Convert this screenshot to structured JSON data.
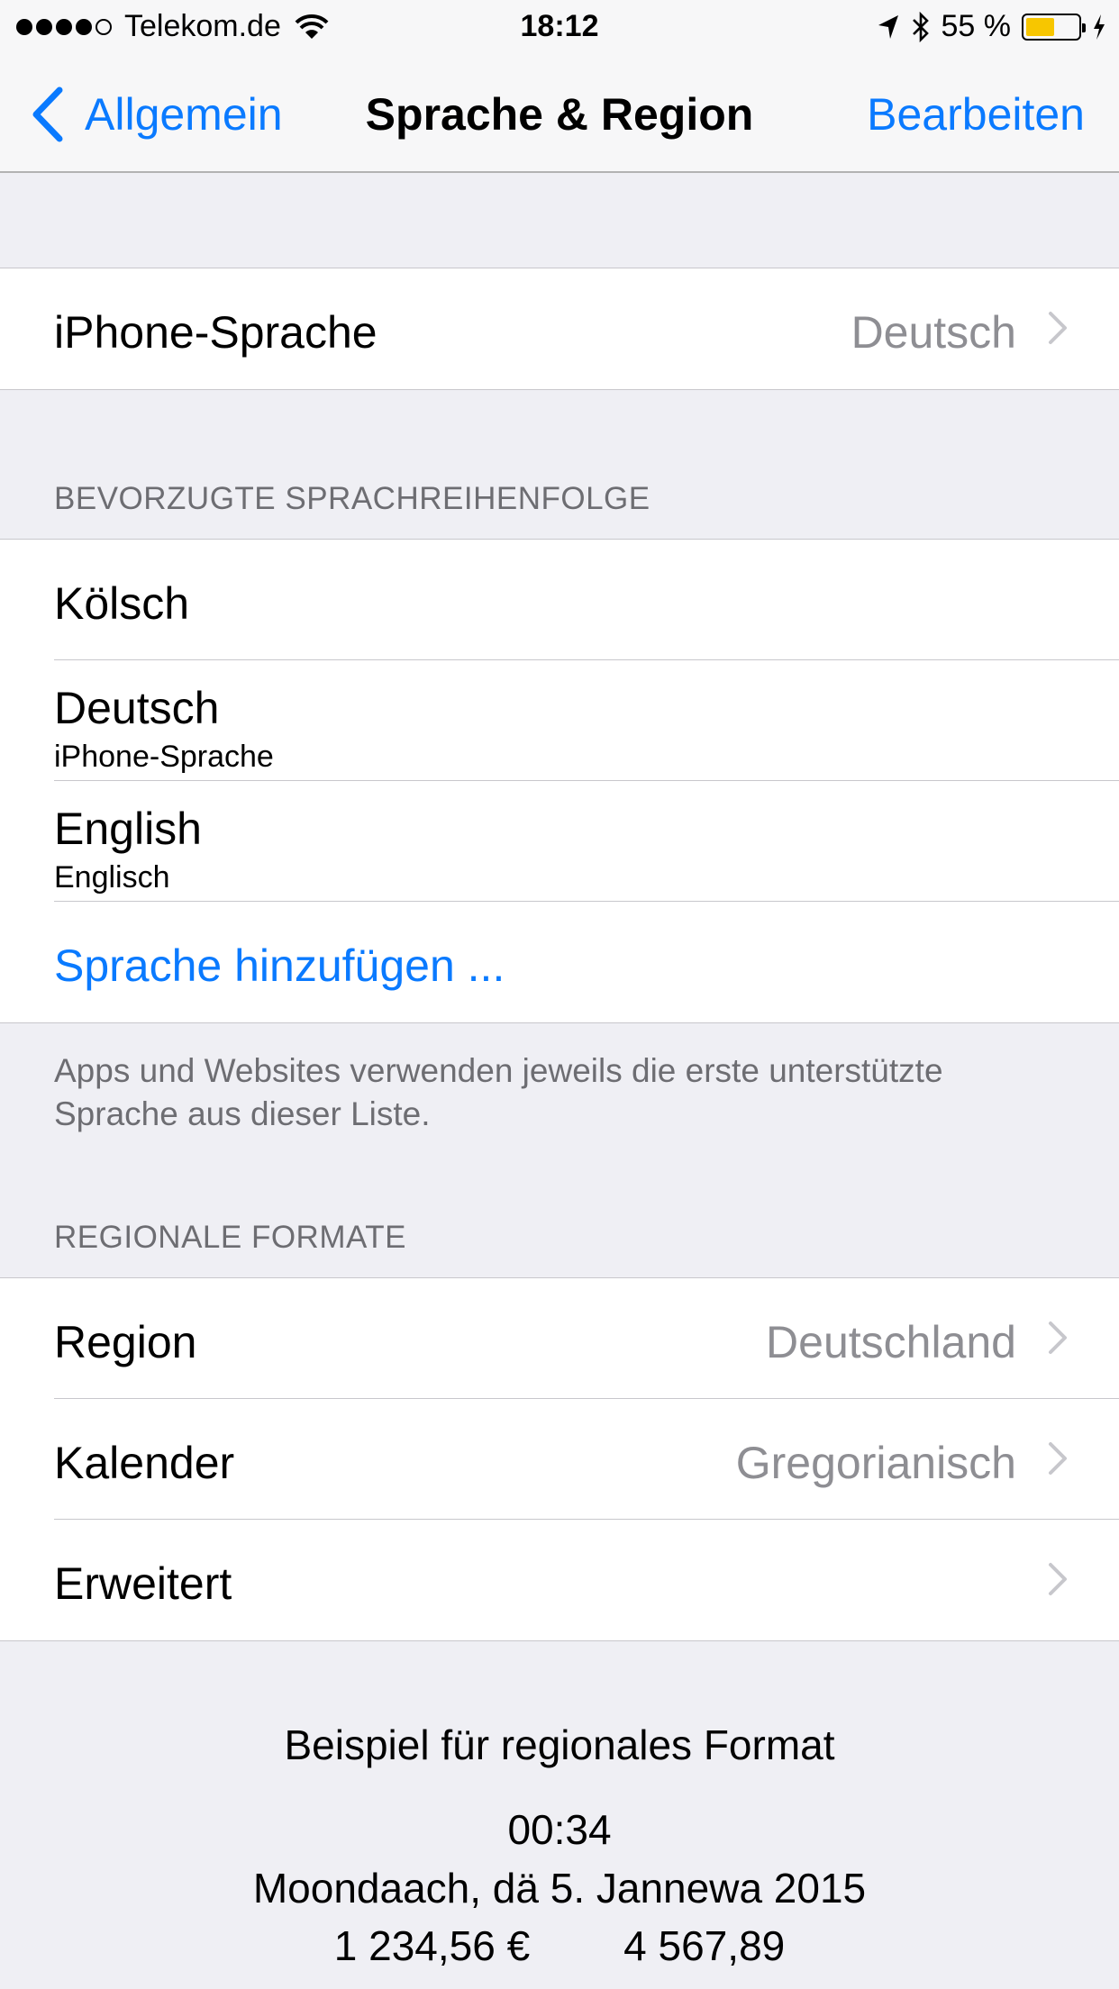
{
  "status_bar": {
    "carrier": "Telekom.de",
    "time": "18:12",
    "battery_percent": "55 %",
    "battery_level": 0.55,
    "signal_bars": 4,
    "signal_total": 5
  },
  "nav": {
    "back_label": "Allgemein",
    "title": "Sprache & Region",
    "edit_label": "Bearbeiten"
  },
  "iphone_language": {
    "label": "iPhone-Sprache",
    "value": "Deutsch"
  },
  "preferred": {
    "header": "BEVORZUGTE SPRACHREIHENFOLGE",
    "languages": [
      {
        "name": "Kölsch",
        "sub": ""
      },
      {
        "name": "Deutsch",
        "sub": "iPhone-Sprache"
      },
      {
        "name": "English",
        "sub": "Englisch"
      }
    ],
    "add_label": "Sprache hinzufügen ...",
    "footer": "Apps und Websites verwenden jeweils die erste unterstützte Sprache aus dieser Liste."
  },
  "regional": {
    "header": "REGIONALE FORMATE",
    "rows": [
      {
        "label": "Region",
        "value": "Deutschland"
      },
      {
        "label": "Kalender",
        "value": "Gregorianisch"
      },
      {
        "label": "Erweitert",
        "value": ""
      }
    ]
  },
  "example": {
    "title": "Beispiel für regionales Format",
    "time": "00:34",
    "date": "Moondaach, dä 5. Jannewa 2015",
    "currency": "1 234,56 €",
    "number": "4 567,89"
  },
  "colors": {
    "accent": "#0a7aff",
    "battery": "#f7c600",
    "background": "#efeff4"
  }
}
